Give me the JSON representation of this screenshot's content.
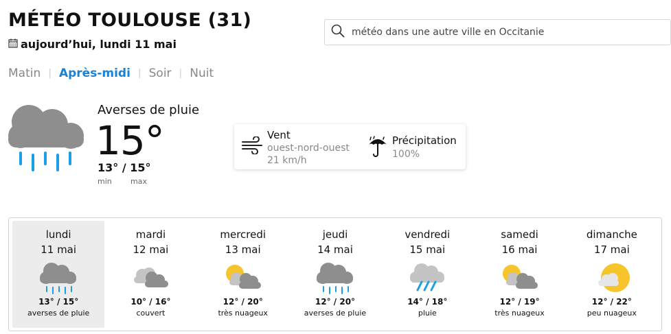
{
  "header": {
    "title": "MÉTÉO TOULOUSE (31)",
    "date": "aujourd’hui, lundi 11 mai"
  },
  "search": {
    "placeholder": "météo dans une autre ville en Occitanie"
  },
  "periods": [
    {
      "label": "Matin",
      "active": false
    },
    {
      "label": "Après-midi",
      "active": true
    },
    {
      "label": "Soir",
      "active": false
    },
    {
      "label": "Nuit",
      "active": false
    }
  ],
  "current": {
    "condition": "Averses de pluie",
    "temperature": "15°",
    "minmax": "13° / 15°",
    "min_label": "min",
    "max_label": "max",
    "icon": "rain-cloud-icon"
  },
  "details": {
    "wind_title": "Vent",
    "wind_direction": "ouest-nord-ouest",
    "wind_speed": "21 km/h",
    "precip_title": "Précipitation",
    "precip_value": "100%"
  },
  "colors": {
    "accent": "#1a82d4",
    "rain": "#1a9ee6",
    "cloud": "#8e8e8e",
    "sun": "#f7c52b"
  },
  "forecast": [
    {
      "day": "lundi",
      "date": "11 mai",
      "temps": "13° / 15°",
      "condition": "averses de pluie",
      "icon": "shower-cloud-icon",
      "selected": true
    },
    {
      "day": "mardi",
      "date": "12 mai",
      "temps": "10° / 16°",
      "condition": "couvert",
      "icon": "overcast-icon",
      "selected": false
    },
    {
      "day": "mercredi",
      "date": "13 mai",
      "temps": "12° / 20°",
      "condition": "très nuageux",
      "icon": "very-cloudy-icon",
      "selected": false
    },
    {
      "day": "jeudi",
      "date": "14 mai",
      "temps": "12° / 20°",
      "condition": "averses de pluie",
      "icon": "shower-cloud-icon",
      "selected": false
    },
    {
      "day": "vendredi",
      "date": "15 mai",
      "temps": "14° / 18°",
      "condition": "pluie",
      "icon": "rain-icon",
      "selected": false
    },
    {
      "day": "samedi",
      "date": "16 mai",
      "temps": "12° / 19°",
      "condition": "très nuageux",
      "icon": "very-cloudy-icon",
      "selected": false
    },
    {
      "day": "dimanche",
      "date": "17 mai",
      "temps": "12° / 22°",
      "condition": "peu nuageux",
      "icon": "partly-cloudy-icon",
      "selected": false
    }
  ]
}
